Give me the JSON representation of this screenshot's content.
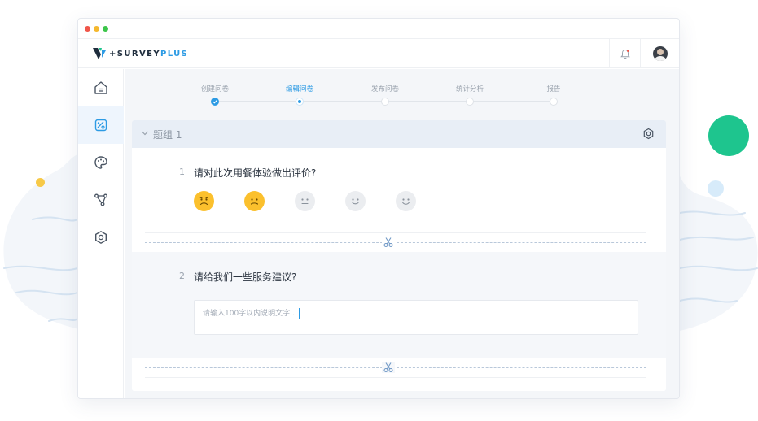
{
  "app": {
    "brand_prefix": "+",
    "brand_name": "SURVEY",
    "brand_suffix": "PLUS"
  },
  "colors": {
    "accent": "#2d9be4",
    "brand_green": "#1ec58e",
    "rating_active": "#fbc02d",
    "rating_inactive": "#ebedf0"
  },
  "header": {
    "icons": [
      "bell-icon",
      "avatar"
    ]
  },
  "sidebar": {
    "items": [
      {
        "icon": "home-icon",
        "active": false
      },
      {
        "icon": "edit-survey-icon",
        "active": true
      },
      {
        "icon": "palette-icon",
        "active": false
      },
      {
        "icon": "flow-icon",
        "active": false
      },
      {
        "icon": "hexagon-settings-icon",
        "active": false
      }
    ]
  },
  "steps": [
    {
      "label": "创建问卷",
      "state": "done"
    },
    {
      "label": "编辑问卷",
      "state": "current"
    },
    {
      "label": "发布问卷",
      "state": "pending"
    },
    {
      "label": "统计分析",
      "state": "pending"
    },
    {
      "label": "报告",
      "state": "pending"
    }
  ],
  "group": {
    "title": "题组 1"
  },
  "questions": [
    {
      "number": "1",
      "text": "请对此次用餐体验做出评价?",
      "rating": {
        "max": 5,
        "value": 2
      }
    },
    {
      "number": "2",
      "text": "请给我们一些服务建议?",
      "placeholder": "请输入100字以内说明文字…"
    }
  ]
}
